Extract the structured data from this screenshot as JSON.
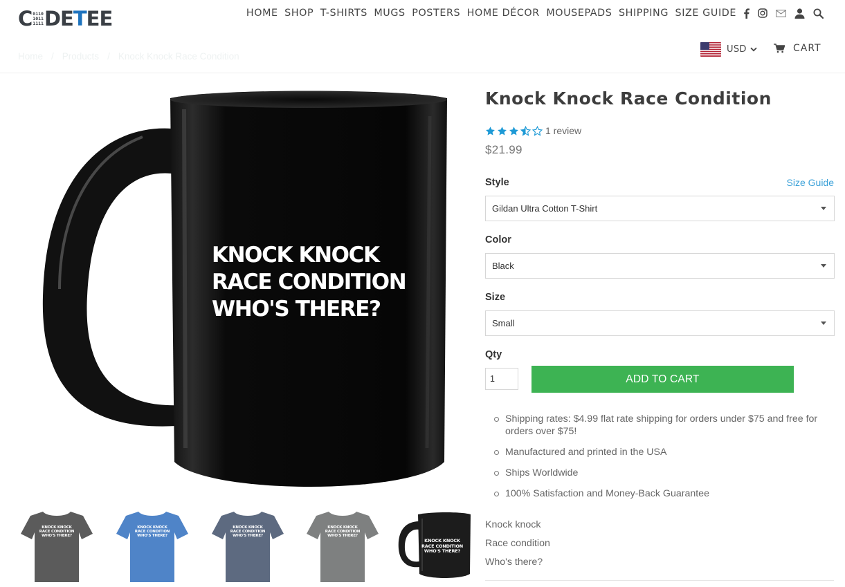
{
  "brand": {
    "logo_c": "C",
    "logo_bits": [
      "0110",
      "1011",
      "1111"
    ],
    "logo_de": "DE",
    "logo_t": "T",
    "logo_ee": "EE",
    "accent_color": "#1e73be"
  },
  "nav": {
    "items": [
      "HOME",
      "SHOP",
      "T-SHIRTS",
      "MUGS",
      "POSTERS",
      "HOME DÉCOR",
      "MOUSEPADS",
      "SHIPPING",
      "SIZE GUIDE"
    ],
    "icons": [
      "facebook-icon",
      "instagram-icon",
      "mail-icon",
      "account-icon",
      "search-icon"
    ]
  },
  "currency": {
    "code": "USD",
    "flag": "us-flag-icon"
  },
  "cart": {
    "label": "CART"
  },
  "breadcrumb": [
    "Home",
    "/",
    "Products",
    "/",
    "Knock Knock Race Condition"
  ],
  "product": {
    "title": "Knock Knock Race Condition",
    "rating": 3.5,
    "rating_max": 5,
    "review_text": "1 review",
    "price": "$21.99",
    "image_text": [
      "KNOCK KNOCK",
      "RACE CONDITION",
      "WHO'S THERE?"
    ],
    "thumbnails": [
      {
        "kind": "tshirt",
        "color": "#5b5b5b"
      },
      {
        "kind": "tshirt",
        "color": "#4f84c8"
      },
      {
        "kind": "tshirt",
        "color": "#5d6a80"
      },
      {
        "kind": "tshirt",
        "color": "#7e8080"
      },
      {
        "kind": "mug",
        "color": "#1c1c1c"
      }
    ]
  },
  "options": {
    "style_label": "Style",
    "size_guide_link": "Size Guide",
    "style_value": "Gildan Ultra Cotton T-Shirt",
    "color_label": "Color",
    "color_value": "Black",
    "size_label": "Size",
    "size_value": "Small",
    "qty_label": "Qty",
    "qty_value": "1",
    "add_to_cart": "ADD TO CART",
    "add_to_cart_color": "#3db353"
  },
  "features": [
    "Shipping rates: $4.99 flat rate shipping for orders under $75 and free for orders over $75!",
    "Manufactured and printed in the USA",
    "Ships Worldwide",
    "100% Satisfaction and Money-Back Guarantee"
  ],
  "description": [
    "Knock knock",
    "Race condition",
    "Who's there?"
  ]
}
